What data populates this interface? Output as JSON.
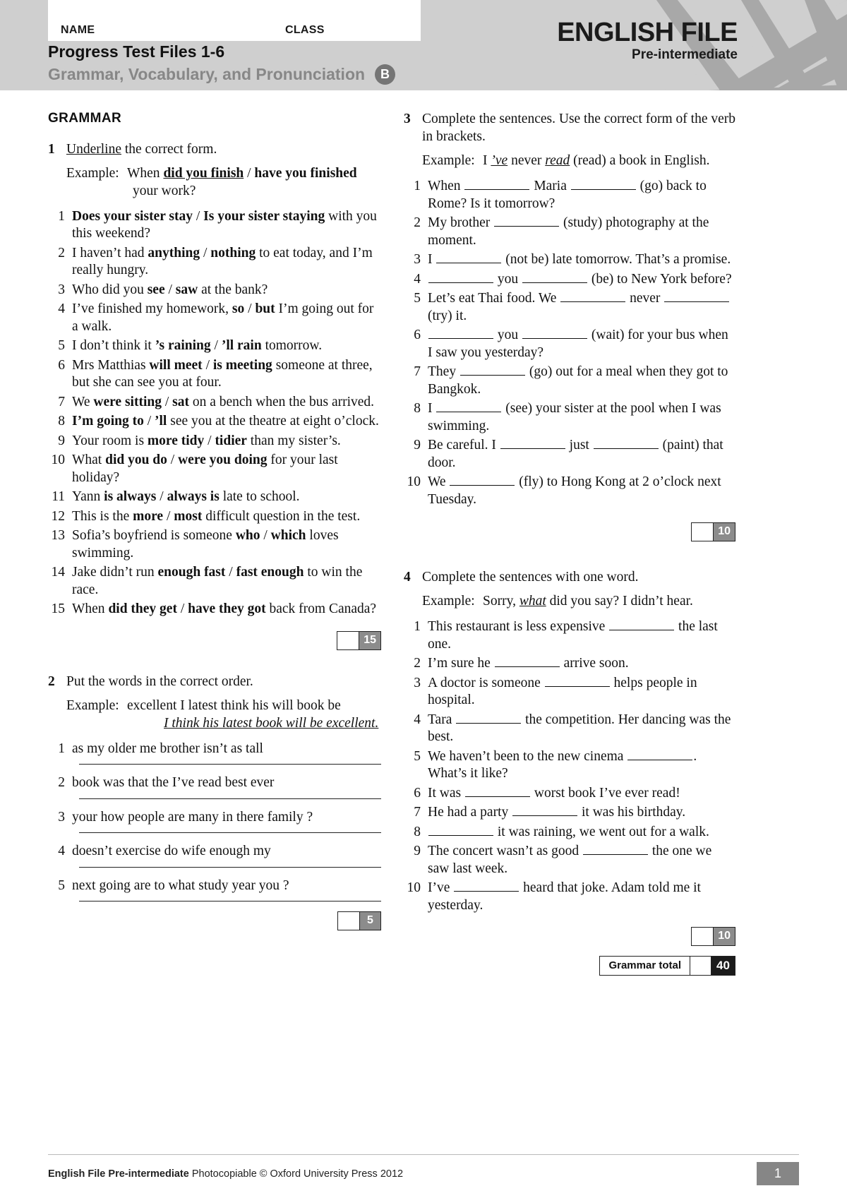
{
  "header": {
    "name_label": "NAME",
    "class_label": "CLASS",
    "title_line1": "Progress Test  Files 1-6",
    "title_line2": "Grammar, Vocabulary, and Pronunciation",
    "version_badge": "B",
    "brand_main": "ENGLISH FILE",
    "brand_sub": "Pre-intermediate"
  },
  "section": {
    "grammar_heading": "GRAMMAR"
  },
  "exercise1": {
    "number": "1",
    "instruction_underlined": "Underline",
    "instruction_rest": " the correct form.",
    "example_label": "Example:",
    "example_pre": "When ",
    "example_opt1": "did you finish",
    "example_sep": " / ",
    "example_opt2": "have you finished",
    "example_cont": "your work?",
    "items": [
      {
        "n": "1",
        "pre": "",
        "opt1": "Does your sister stay",
        "opt2": "Is your sister staying",
        "post": " with you this weekend?"
      },
      {
        "n": "2",
        "pre": "I haven’t had ",
        "opt1": "anything",
        "opt2": "nothing",
        "post": " to eat today, and I’m really hungry."
      },
      {
        "n": "3",
        "pre": "Who did you ",
        "opt1": "see",
        "opt2": "saw",
        "post": " at the bank?"
      },
      {
        "n": "4",
        "pre": "I’ve finished my homework, ",
        "opt1": "so",
        "opt2": "but",
        "post": " I’m going out for a walk."
      },
      {
        "n": "5",
        "pre": "I don’t think it ",
        "opt1": "’s raining",
        "opt2": "’ll rain",
        "post": " tomorrow."
      },
      {
        "n": "6",
        "pre": "Mrs Matthias ",
        "opt1": "will meet",
        "opt2": "is meeting",
        "post": " someone at three, but she can see you at four."
      },
      {
        "n": "7",
        "pre": "We ",
        "opt1": "were sitting",
        "opt2": "sat",
        "post": " on a bench when the bus arrived."
      },
      {
        "n": "8",
        "pre": "",
        "opt1": "I’m going to",
        "opt2": "’ll",
        "post": " see you at the theatre at eight o’clock."
      },
      {
        "n": "9",
        "pre": "Your room is ",
        "opt1": "more tidy",
        "opt2": "tidier",
        "post": " than my sister’s."
      },
      {
        "n": "10",
        "pre": "What ",
        "opt1": "did you do",
        "opt2": "were you doing",
        "post": " for your last holiday?"
      },
      {
        "n": "11",
        "pre": "Yann ",
        "opt1": "is always",
        "opt2": "always is",
        "post": " late to school."
      },
      {
        "n": "12",
        "pre": "This is the ",
        "opt1": "more",
        "opt2": "most",
        "post": " difficult question in the test."
      },
      {
        "n": "13",
        "pre": "Sofia’s boyfriend is someone ",
        "opt1": "who",
        "opt2": "which",
        "post": " loves swimming."
      },
      {
        "n": "14",
        "pre": "Jake didn’t run ",
        "opt1": "enough fast",
        "opt2": "fast enough",
        "post": " to win the race."
      },
      {
        "n": "15",
        "pre": "When ",
        "opt1": "did they get",
        "opt2": "have they got",
        "post": " back from Canada?"
      }
    ],
    "score": "15"
  },
  "exercise2": {
    "number": "2",
    "instruction": "Put the words in the correct order.",
    "example_label": "Example:",
    "example_prompt": "excellent I latest think his will book be",
    "example_answer": "I think his latest book will be excellent.",
    "items": [
      {
        "n": "1",
        "text": "as my older me brother isn’t as tall"
      },
      {
        "n": "2",
        "text": "book was that the I’ve read best ever"
      },
      {
        "n": "3",
        "text": "your how people are many in there family ?"
      },
      {
        "n": "4",
        "text": "doesn’t exercise do wife enough my"
      },
      {
        "n": "5",
        "text": "next going are to what study year you ?"
      }
    ],
    "score": "5"
  },
  "exercise3": {
    "number": "3",
    "instruction": "Complete the sentences. Use the correct form of the verb in brackets.",
    "example_label": "Example:",
    "example_pre": "I ",
    "example_ans1": "’ve",
    "example_mid": " never ",
    "example_ans2": "read",
    "example_post": " (read) a book in English.",
    "items": [
      {
        "n": "1",
        "parts": [
          "When ",
          "BLANK",
          " Maria ",
          "BLANK",
          " (go) back to Rome? Is it tomorrow?"
        ]
      },
      {
        "n": "2",
        "parts": [
          "My brother ",
          "BLANK",
          " (study) photography at the moment."
        ]
      },
      {
        "n": "3",
        "parts": [
          "I ",
          "BLANK",
          " (not be) late tomorrow. That’s a promise."
        ]
      },
      {
        "n": "4",
        "parts": [
          "",
          "BLANK",
          " you ",
          "BLANK",
          " (be) to New York before?"
        ]
      },
      {
        "n": "5",
        "parts": [
          "Let’s eat Thai food. We ",
          "BLANK",
          " never ",
          "BLANK",
          " (try) it."
        ]
      },
      {
        "n": "6",
        "parts": [
          "",
          "BLANK",
          " you ",
          "BLANK",
          " (wait) for your bus when I saw you yesterday?"
        ]
      },
      {
        "n": "7",
        "parts": [
          "They ",
          "BLANK",
          " (go) out for a meal when they got to Bangkok."
        ]
      },
      {
        "n": "8",
        "parts": [
          "I ",
          "BLANK",
          " (see) your sister at the pool when I was swimming."
        ]
      },
      {
        "n": "9",
        "parts": [
          "Be careful. I ",
          "BLANK",
          " just ",
          "BLANK",
          " (paint) that door."
        ]
      },
      {
        "n": "10",
        "parts": [
          "We ",
          "BLANK",
          " (fly) to Hong Kong at 2 o’clock next Tuesday."
        ]
      }
    ],
    "score": "10"
  },
  "exercise4": {
    "number": "4",
    "instruction": "Complete the sentences with one word.",
    "example_label": "Example:",
    "example_pre": "Sorry, ",
    "example_ans": "what",
    "example_post": " did you say? I didn’t hear.",
    "items": [
      {
        "n": "1",
        "parts": [
          "This restaurant is less expensive ",
          "BLANK",
          " the last one."
        ]
      },
      {
        "n": "2",
        "parts": [
          "I’m sure he ",
          "BLANK",
          " arrive soon."
        ]
      },
      {
        "n": "3",
        "parts": [
          "A doctor is someone ",
          "BLANK",
          " helps people in hospital."
        ]
      },
      {
        "n": "4",
        "parts": [
          "Tara ",
          "BLANK",
          " the competition. Her dancing was the best."
        ]
      },
      {
        "n": "5",
        "parts": [
          "We haven’t been to the new cinema ",
          "BLANK",
          ". What’s it like?"
        ]
      },
      {
        "n": "6",
        "parts": [
          "It was ",
          "BLANK",
          " worst book I’ve ever read!"
        ]
      },
      {
        "n": "7",
        "parts": [
          "He had a party ",
          "BLANK",
          " it was his birthday."
        ]
      },
      {
        "n": "8",
        "parts": [
          "",
          "BLANK",
          " it was raining, we went out for a walk."
        ]
      },
      {
        "n": "9",
        "parts": [
          "The concert wasn’t as good ",
          "BLANK",
          " the one we saw last week."
        ]
      },
      {
        "n": "10",
        "parts": [
          "I’ve ",
          "BLANK",
          " heard that joke. Adam told me it yesterday."
        ]
      }
    ],
    "score": "10"
  },
  "grammar_total": {
    "label": "Grammar total",
    "value": "40"
  },
  "footer": {
    "strong": "English File Pre-intermediate",
    "rest": " Photocopiable © Oxford University Press 2012",
    "page": "1"
  }
}
